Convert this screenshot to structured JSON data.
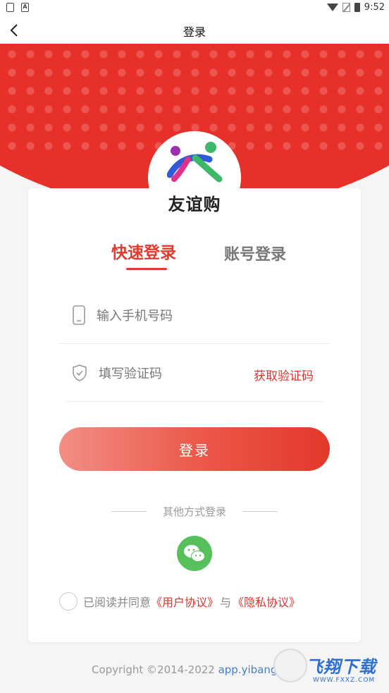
{
  "status_bar": {
    "time": "9:52",
    "left_icons": [
      "app-notification-icon",
      "a-notification-icon"
    ],
    "right_icons": [
      "wifi-icon",
      "no-sim-icon",
      "battery-icon"
    ]
  },
  "nav": {
    "title": "登录",
    "back_icon": "chevron-left-icon"
  },
  "brand": {
    "logo_text": "友谊购"
  },
  "tabs": [
    {
      "label": "快速登录",
      "active": true
    },
    {
      "label": "账号登录",
      "active": false
    }
  ],
  "form": {
    "phone_placeholder": "输入手机号码",
    "code_placeholder": "填写验证码",
    "get_code_label": "获取验证码",
    "login_label": "登录"
  },
  "other_login": {
    "label": "其他方式登录",
    "methods": [
      "wechat-icon"
    ]
  },
  "agreement": {
    "prefix": "已阅读并同意",
    "user_agreement": "《用户协议》",
    "joiner": "与",
    "privacy_agreement": "《隐私协议》"
  },
  "footer": {
    "copyright": "Copyright ©2014-2022 ",
    "url": "app.yibang198"
  },
  "watermark": {
    "title": "飞翔下载",
    "url": "WWW.FXXZ.COM"
  },
  "colors": {
    "primary_red": "#e8302a",
    "accent_red": "#d9352a",
    "wechat_green": "#58c05a",
    "link_blue": "#4a7ec8"
  }
}
